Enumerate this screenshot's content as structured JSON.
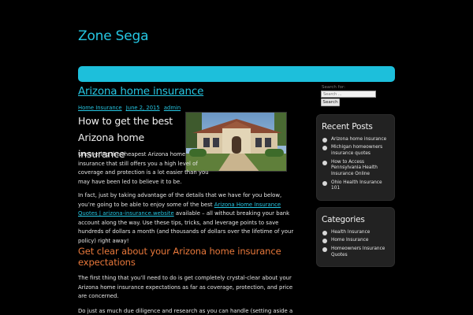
{
  "site": {
    "title": "Zone Sega"
  },
  "post": {
    "title": "Arizona home insurance",
    "meta": {
      "category": "Home Insurance",
      "date": "June 2, 2015",
      "author": "admin"
    },
    "subhead": "How to get the best Arizona home insurance",
    "paragraph1": "Uncovering the cheapest Arizona home insurance that still offers you a high level of coverage and protection is a lot easier than you may have been led to believe it to be.",
    "paragraph2_before": "In fact, just by taking advantage of the details that we have for you below, you’re going to be able to enjoy some of the best ",
    "paragraph2_link": "Arizona Home Insurance Quotes | arizona-insurance.website",
    "paragraph2_after": " available – all without breaking your bank account along the way. Use these tips, tricks, and leverage points to save hundreds of dollars a month (and thousands of dollars over the lifetime of your policy) right away!",
    "heading2": "Get clear about your Arizona home insurance expectations",
    "paragraph3": "The first thing that you’ll need to do is get completely crystal-clear about your Arizona home insurance expectations as far as coverage, protection, and price are concerned.",
    "paragraph4": "Do just as much due diligence and research as you can handle (setting aside a"
  },
  "sidebar": {
    "search": {
      "label": "Search for:",
      "placeholder": "Search ...",
      "button": "Search"
    },
    "recent_posts": {
      "title": "Recent Posts",
      "items": [
        "Arizona home insurance",
        "Michigan homeowners insurance quotes",
        "How to Access Pennsylvania Health Insurance Online",
        "Ohio Health Insurance 101"
      ]
    },
    "categories": {
      "title": "Categories",
      "items": [
        "Health Insurance",
        "Home Insurance",
        "Homeowners Insurance Quotes"
      ]
    }
  },
  "colors": {
    "accent": "#1dbfdb",
    "heading2": "#e8783b",
    "background": "#000000",
    "widget": "#222222"
  }
}
